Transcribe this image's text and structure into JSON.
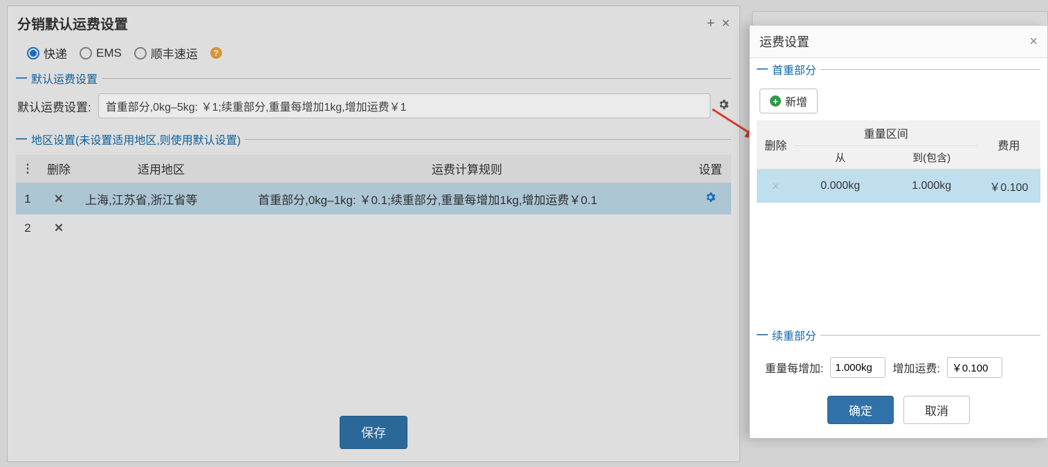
{
  "main": {
    "title": "分销默认运费设置",
    "radios": [
      {
        "label": "快递",
        "selected": true
      },
      {
        "label": "EMS",
        "selected": false
      },
      {
        "label": "顺丰速运",
        "selected": false
      }
    ],
    "section_default": {
      "legend": "默认运费设置",
      "label": "默认运费设置:",
      "value": "首重部分,0kg–5kg: ￥1;续重部分,重量每增加1kg,增加运费￥1"
    },
    "section_area": {
      "legend": "地区设置(未设置适用地区,则使用默认设置)",
      "headers": {
        "idx": "",
        "del": "删除",
        "area": "适用地区",
        "rule": "运费计算规则",
        "cfg": "设置"
      },
      "rows": [
        {
          "idx": "1",
          "area": "上海,江苏省,浙江省等",
          "rule": "首重部分,0kg–1kg: ￥0.1;续重部分,重量每增加1kg,增加运费￥0.1",
          "selected": true
        },
        {
          "idx": "2",
          "area": "",
          "rule": "",
          "selected": false
        }
      ]
    },
    "save_label": "保存"
  },
  "side": {
    "title": "运费设置",
    "section_first": {
      "legend": "首重部分",
      "add_label": "新增",
      "headers": {
        "del": "删除",
        "weight_range": "重量区间",
        "from": "从",
        "to": "到(包含)",
        "fee": "费用"
      },
      "rows": [
        {
          "from": "0.000kg",
          "to": "1.000kg",
          "fee": "￥0.100"
        }
      ]
    },
    "section_cont": {
      "legend": "续重部分",
      "inc_label": "重量每增加:",
      "inc_value": "1.000kg",
      "fee_label": "增加运费:",
      "fee_value": "￥0.100"
    },
    "ok_label": "确定",
    "cancel_label": "取消"
  }
}
